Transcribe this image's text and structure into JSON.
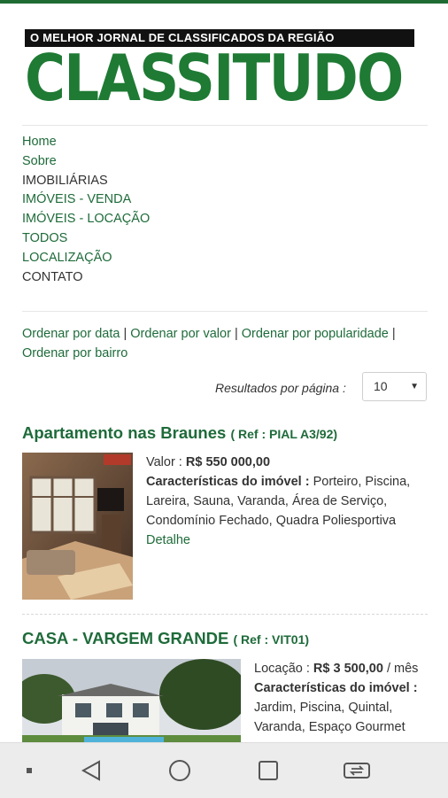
{
  "header": {
    "tagline": "O MELHOR JORNAL DE CLASSIFICADOS DA REGIÃO",
    "logo": "CLASSITUDO"
  },
  "menu": [
    {
      "label": "Home"
    },
    {
      "label": "Sobre"
    },
    {
      "label": "IMOBILIÁRIAS"
    },
    {
      "label": "IMÓVEIS - VENDA"
    },
    {
      "label": "IMÓVEIS - LOCAÇÃO"
    },
    {
      "label": "TODOS"
    },
    {
      "label": "LOCALIZAÇÃO"
    },
    {
      "label": "CONTATO"
    }
  ],
  "sort": {
    "by_date": "Ordenar por data",
    "by_value": "Ordenar por valor",
    "by_popularity": "Ordenar por popularidade",
    "by_neighborhood": "Ordenar por bairro",
    "separator": "|"
  },
  "results": {
    "label": "Resultados por página :",
    "selected": "10"
  },
  "listings": [
    {
      "title": "Apartamento nas Braunes",
      "ref": "( Ref : PIAL A3/92)",
      "price_label": "Valor :",
      "price": "R$ 550 000,00",
      "features_label": "Características do imóvel :",
      "features": "Porteiro, Piscina, Lareira, Sauna, Varanda, Área de Serviço, Condomínio Fechado, Quadra Poliesportiva",
      "detail": "Detalhe"
    },
    {
      "title": "CASA - VARGEM GRANDE",
      "ref": "( Ref : VIT01)",
      "price_label": "Locação :",
      "price": "R$ 3 500,00",
      "price_suffix": "/ mês",
      "features_label": "Características do imóvel :",
      "features": "Jardim, Piscina, Quintal, Varanda, Espaço Gourmet"
    }
  ],
  "colors": {
    "brand_green": "#1f7a34",
    "link_green": "#1e6b3a"
  }
}
